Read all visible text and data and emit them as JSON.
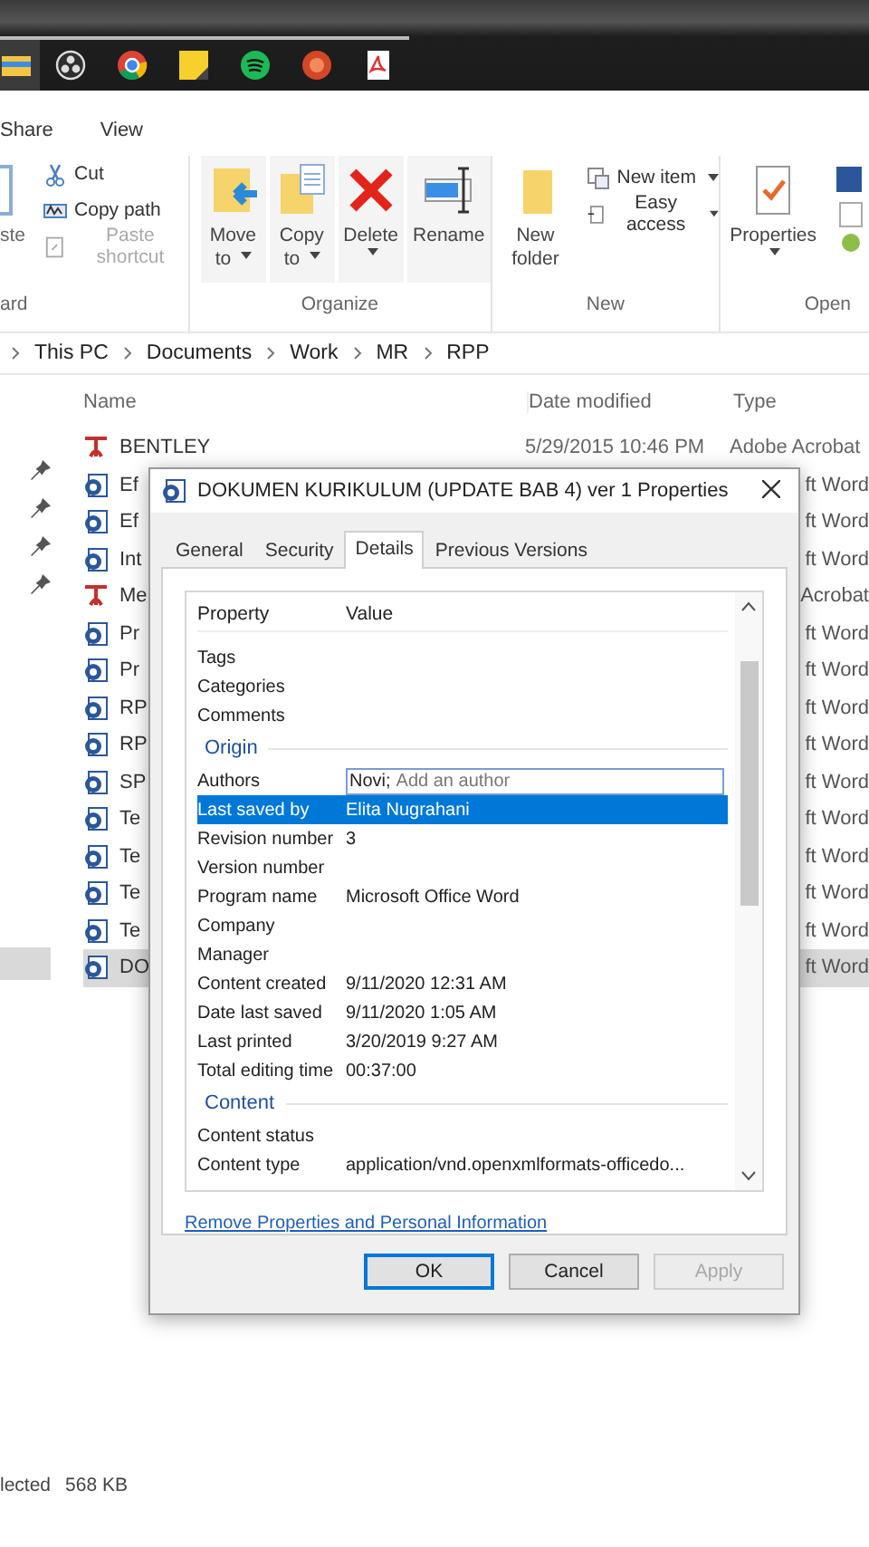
{
  "taskbar": {
    "apps": [
      {
        "kind": "explorer",
        "selected": true
      },
      {
        "kind": "obs",
        "selected": false
      },
      {
        "kind": "chrome",
        "selected": false
      },
      {
        "kind": "notes",
        "selected": false
      },
      {
        "kind": "spotify",
        "selected": false
      },
      {
        "kind": "powerpoint",
        "selected": false
      },
      {
        "kind": "pdf",
        "selected": false
      }
    ]
  },
  "ribbon": {
    "tabs": [
      "Share",
      "View"
    ],
    "clipboard": {
      "fragment": "ste",
      "group_label": "ard",
      "items": [
        {
          "kind": "cut",
          "label": "Cut",
          "disabled": false
        },
        {
          "kind": "copy-path",
          "label": "Copy path",
          "disabled": false
        },
        {
          "kind": "paste-shortcut",
          "label": "Paste shortcut",
          "disabled": true
        }
      ]
    },
    "organize": {
      "group_label": "Organize",
      "buttons": [
        {
          "kind": "move",
          "lines": [
            "Move",
            "to"
          ],
          "dropdown": true
        },
        {
          "kind": "copy",
          "lines": [
            "Copy",
            "to"
          ],
          "dropdown": true
        },
        {
          "kind": "delete",
          "lines": [
            "Delete"
          ],
          "dropdown": true
        },
        {
          "kind": "rename",
          "lines": [
            "Rename"
          ],
          "dropdown": false
        }
      ]
    },
    "new": {
      "group_label": "New",
      "buttons": [
        {
          "kind": "new-folder",
          "lines": [
            "New",
            "folder"
          ],
          "dropdown": false
        }
      ],
      "items": [
        {
          "kind": "new-item",
          "label": "New item",
          "dropdown": true
        },
        {
          "kind": "easy-access",
          "label": "Easy access",
          "dropdown": true
        }
      ]
    },
    "open": {
      "group_label": "Open",
      "buttons": [
        {
          "kind": "properties",
          "lines": [
            "Properties"
          ],
          "dropdown": true
        }
      ]
    }
  },
  "address": {
    "crumbs": [
      "This PC",
      "Documents",
      "Work",
      "MR",
      "RPP"
    ]
  },
  "columns": [
    "Name",
    "Date modified",
    "Type"
  ],
  "nav_pane": {
    "items": [
      {
        "pinned": true,
        "selected": false
      },
      {
        "pinned": true,
        "selected": false
      },
      {
        "pinned": true,
        "selected": false
      },
      {
        "pinned": true,
        "selected": false
      },
      {
        "pinned": false,
        "selected": true
      }
    ]
  },
  "files": [
    {
      "kind": "pdf",
      "name": "BENTLEY",
      "date": "5/29/2015 10:46 PM",
      "type": "Adobe Acrobat",
      "selected": false
    },
    {
      "kind": "word",
      "name": "Ef",
      "type": "ft Word",
      "selected": false
    },
    {
      "kind": "word",
      "name": "Ef",
      "type": "ft Word",
      "selected": false
    },
    {
      "kind": "word",
      "name": "Int",
      "type": "ft Word",
      "selected": false
    },
    {
      "kind": "pdf",
      "name": "Me",
      "type": "Acrobat",
      "selected": false
    },
    {
      "kind": "word",
      "name": "Pr",
      "type": "ft Word",
      "selected": false
    },
    {
      "kind": "word",
      "name": "Pr",
      "type": "ft Word",
      "selected": false
    },
    {
      "kind": "word",
      "name": "RP",
      "type": "ft Word",
      "selected": false
    },
    {
      "kind": "word",
      "name": "RP",
      "type": "ft Word",
      "selected": false
    },
    {
      "kind": "word",
      "name": "SP",
      "type": "ft Word",
      "selected": false
    },
    {
      "kind": "word",
      "name": "Te",
      "type": "ft Word",
      "selected": false
    },
    {
      "kind": "word",
      "name": "Te",
      "type": "ft Word",
      "selected": false
    },
    {
      "kind": "word",
      "name": "Te",
      "type": "ft Word",
      "selected": false
    },
    {
      "kind": "word",
      "name": "Te",
      "type": "ft Word",
      "selected": false
    },
    {
      "kind": "word",
      "name": "DO",
      "type": "ft Word",
      "selected": true
    }
  ],
  "dialog": {
    "title": "DOKUMEN KURIKULUM (UPDATE BAB 4) ver 1 Properties",
    "tabs": [
      {
        "label": "General",
        "selected": false
      },
      {
        "label": "Security",
        "selected": false
      },
      {
        "label": "Details",
        "selected": true
      },
      {
        "label": "Previous Versions",
        "selected": false
      }
    ],
    "columns": [
      "Property",
      "Value"
    ],
    "rows": [
      {
        "kind": "row",
        "property": "Tags",
        "selected": false
      },
      {
        "kind": "row",
        "property": "Categories",
        "selected": false
      },
      {
        "kind": "row",
        "property": "Comments",
        "selected": false
      },
      {
        "kind": "group",
        "label": "Origin"
      },
      {
        "kind": "field",
        "property": "Authors",
        "value": "Novi;",
        "placeholder": "Add an author",
        "selected": false
      },
      {
        "kind": "row",
        "property": "Last saved by",
        "value": "Elita Nugrahani",
        "selected": true
      },
      {
        "kind": "row",
        "property": "Revision number",
        "value": "3",
        "selected": false
      },
      {
        "kind": "row",
        "property": "Version number",
        "selected": false
      },
      {
        "kind": "row",
        "property": "Program name",
        "value": "Microsoft Office Word",
        "selected": false
      },
      {
        "kind": "row",
        "property": "Company",
        "selected": false
      },
      {
        "kind": "row",
        "property": "Manager",
        "selected": false
      },
      {
        "kind": "row",
        "property": "Content created",
        "value": "9/11/2020 12:31 AM",
        "selected": false
      },
      {
        "kind": "row",
        "property": "Date last saved",
        "value": "9/11/2020 1:05 AM",
        "selected": false
      },
      {
        "kind": "row",
        "property": "Last printed",
        "value": "3/20/2019 9:27 AM",
        "selected": false
      },
      {
        "kind": "row",
        "property": "Total editing time",
        "value": "00:37:00",
        "selected": false
      },
      {
        "kind": "group",
        "label": "Content"
      },
      {
        "kind": "row",
        "property": "Content status",
        "selected": false
      },
      {
        "kind": "row",
        "property": "Content type",
        "value": "application/vnd.openxmlformats-officedo...",
        "selected": false
      }
    ],
    "link": "Remove Properties and Personal Information",
    "buttons": [
      {
        "label": "OK",
        "default": true,
        "disabled": false
      },
      {
        "label": "Cancel",
        "default": false,
        "disabled": false
      },
      {
        "label": "Apply",
        "default": false,
        "disabled": true
      }
    ]
  },
  "status_bar": {
    "selection": "lected",
    "size": "568 KB"
  }
}
